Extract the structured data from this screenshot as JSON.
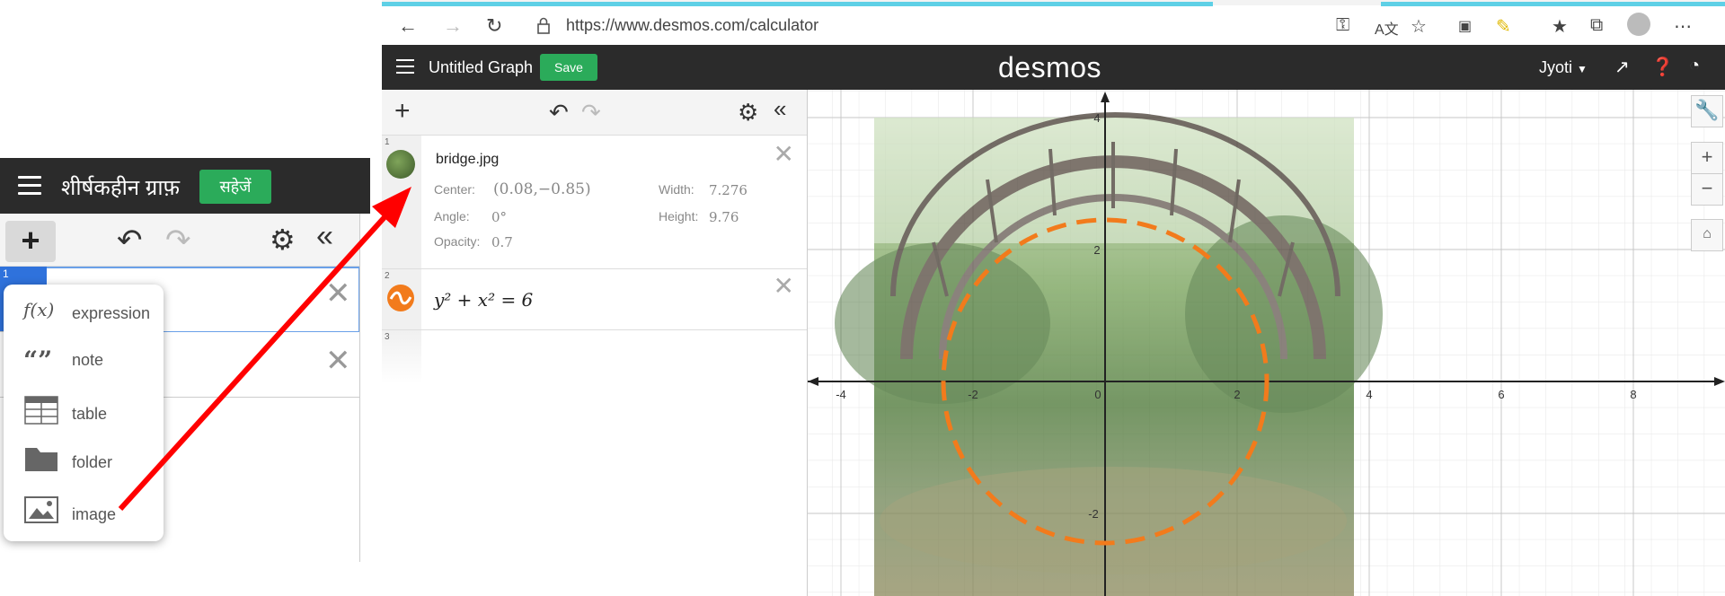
{
  "inset": {
    "title": "शीर्षकहीन ग्राफ़",
    "save_label": "सहेजें",
    "row_index": "1",
    "menu": [
      {
        "icon": "f(x)",
        "icon_name": "function-icon",
        "label": "expression"
      },
      {
        "icon": "“”",
        "icon_name": "quote-icon",
        "label": "note"
      },
      {
        "icon": "",
        "icon_name": "table-icon",
        "label": "table"
      },
      {
        "icon": "",
        "icon_name": "folder-icon",
        "label": "folder"
      },
      {
        "icon": "",
        "icon_name": "image-icon",
        "label": "image"
      }
    ]
  },
  "browser": {
    "url": "https://www.desmos.com/calculator"
  },
  "desmos": {
    "graph_title": "Untitled Graph",
    "save_label": "Save",
    "logo": "desmos",
    "user": "Jyoti",
    "expressions": [
      {
        "index": "1",
        "name": "bridge.jpg",
        "center_label": "Center:",
        "center_value": "(0.08,−0.85)",
        "width_label": "Width:",
        "width_value": "7.276",
        "angle_label": "Angle:",
        "angle_value": "0°",
        "height_label": "Height:",
        "height_value": "9.76",
        "opacity_label": "Opacity:",
        "opacity_value": "0.7"
      },
      {
        "index": "2",
        "latex": "y² + x² = 6"
      },
      {
        "index": "3"
      }
    ]
  },
  "graph": {
    "x_ticks": [
      "-4",
      "-2",
      "0",
      "2",
      "4",
      "6",
      "8"
    ],
    "y_ticks": [
      "4",
      "2",
      "-2"
    ],
    "circle_color": "#f27b1c",
    "accent_green": "#2bab5a",
    "arrow_color": "#ff0000"
  }
}
